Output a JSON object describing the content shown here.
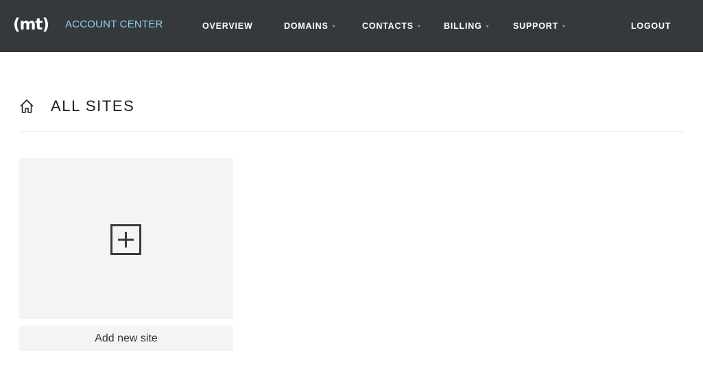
{
  "header": {
    "logo_text": "(mt)",
    "app_name": "ACCOUNT CENTER",
    "nav": [
      {
        "label": "OVERVIEW",
        "has_dropdown": false
      },
      {
        "label": "DOMAINS",
        "has_dropdown": true
      },
      {
        "label": "CONTACTS",
        "has_dropdown": true
      },
      {
        "label": "BILLING",
        "has_dropdown": true
      },
      {
        "label": "SUPPORT",
        "has_dropdown": true
      }
    ],
    "logout_label": "LOGOUT",
    "caret_glyph": "▾"
  },
  "page": {
    "title": "ALL SITES",
    "home_icon": "home-icon"
  },
  "add_site": {
    "icon": "plus-square-icon",
    "label": "Add new site"
  },
  "colors": {
    "header_bg": "#35393c",
    "accent": "#8fd3ea",
    "tile_bg": "#f4f4f4"
  }
}
